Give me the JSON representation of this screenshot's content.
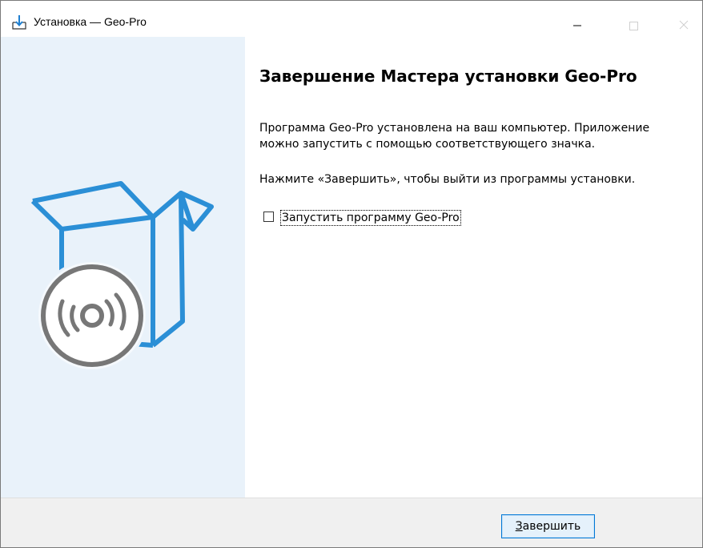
{
  "window": {
    "title": "Установка — Geo-Pro",
    "controls": [
      "minimize-icon",
      "maximize-icon",
      "close-icon"
    ]
  },
  "wizard": {
    "heading": "Завершение Мастера установки Geo-Pro",
    "paragraph1": "Программа Geo-Pro установлена на ваш компьютер. Приложение можно запустить с помощью соответствующего значка.",
    "paragraph2": "Нажмите «Завершить», чтобы выйти из программы установки.",
    "launch_checkbox": {
      "label": "Запустить программу Geo-Pro",
      "checked": false
    },
    "illustration_icon": "software-box-with-disc-icon"
  },
  "footer": {
    "finish_button": {
      "access_key": "З",
      "label_rest": "авершить"
    }
  },
  "colors": {
    "accent_blue": "#2b8fd6",
    "disc_gray": "#777777",
    "sidebar_bg": "#e9f2fa",
    "footer_bg": "#f0f0f0"
  }
}
